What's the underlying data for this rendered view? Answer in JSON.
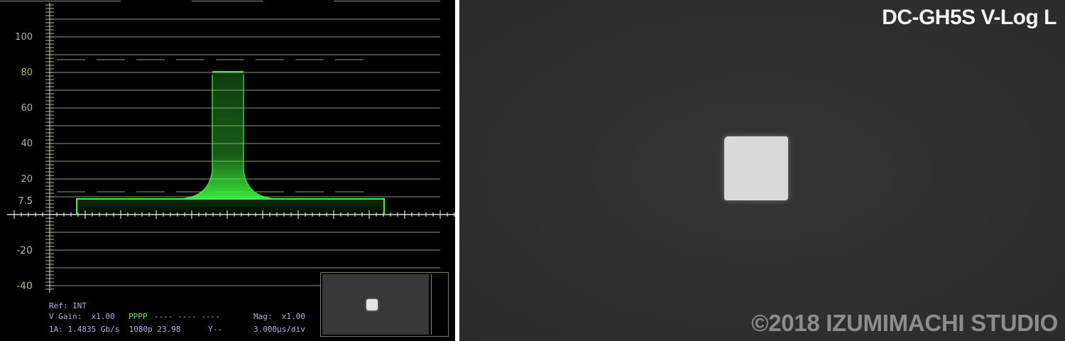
{
  "waveform_monitor": {
    "y_axis_labels": [
      "100",
      "80",
      "60",
      "40",
      "20",
      "7.5",
      "-20",
      "-40"
    ],
    "readout": {
      "ref": "Ref: INT",
      "v_gain": "V Gain:  x1.00",
      "channels_active": "PPPP",
      "channels_inactive": "---- ---- ----",
      "mag": "Mag:  x1.00",
      "signal": "1A: 1.4835 Gb/s  1080p 23.98",
      "y_mode": "Y--",
      "time_div": "3.000µs/div"
    },
    "trace_color": "#3ef23e",
    "graticule_color": "#c8c89a",
    "label_color": "#b5b58a",
    "readout_color": "#a8b4e4"
  },
  "camera_view": {
    "label": "DC-GH5S V-Log L",
    "watermark": "©2018 IZUMIMACHI STUDIO",
    "background_color": "#303030",
    "target_color": "#d9d9d9"
  }
}
